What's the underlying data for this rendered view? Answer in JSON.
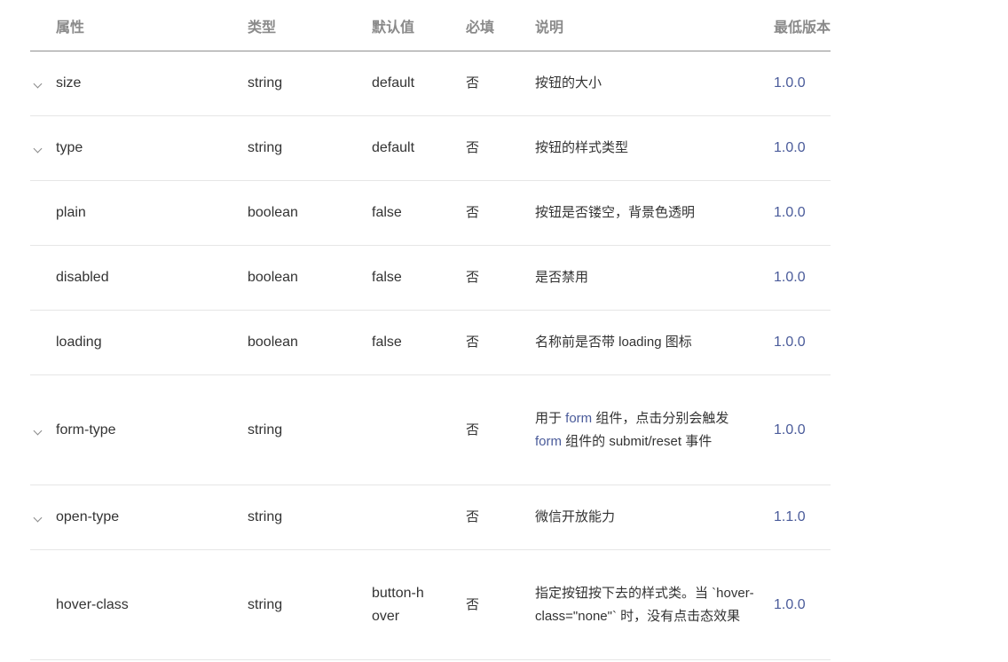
{
  "headers": {
    "attr": "属性",
    "type": "类型",
    "default": "默认值",
    "required": "必填",
    "desc": "说明",
    "version": "最低版本"
  },
  "rows": [
    {
      "expandable": true,
      "attr": "size",
      "type": "string",
      "default": "default",
      "required": "否",
      "desc": "按钮的大小",
      "version": "1.0.0"
    },
    {
      "expandable": true,
      "attr": "type",
      "type": "string",
      "default": "default",
      "required": "否",
      "desc": "按钮的样式类型",
      "version": "1.0.0"
    },
    {
      "expandable": false,
      "attr": "plain",
      "type": "boolean",
      "default": "false",
      "required": "否",
      "desc": "按钮是否镂空，背景色透明",
      "version": "1.0.0"
    },
    {
      "expandable": false,
      "attr": "disabled",
      "type": "boolean",
      "default": "false",
      "required": "否",
      "desc": "是否禁用",
      "version": "1.0.0"
    },
    {
      "expandable": false,
      "attr": "loading",
      "type": "boolean",
      "default": "false",
      "required": "否",
      "desc": "名称前是否带 loading 图标",
      "version": "1.0.0"
    },
    {
      "expandable": true,
      "attr": "form-type",
      "type": "string",
      "default": "",
      "required": "否",
      "desc_parts": {
        "p1": "用于 ",
        "link1": "form",
        "p2": " 组件，点击分别会触发 ",
        "link2": "form",
        "p3": " 组件的 submit/reset 事件"
      },
      "version": "1.0.0"
    },
    {
      "expandable": true,
      "attr": "open-type",
      "type": "string",
      "default": "",
      "required": "否",
      "desc": "微信开放能力",
      "version": "1.1.0"
    },
    {
      "expandable": false,
      "attr": "hover-class",
      "type": "string",
      "default": "button-hover",
      "required": "否",
      "desc": "指定按钮按下去的样式类。当 `hover-class=\"none\"` 时，没有点击态效果",
      "version": "1.0.0"
    }
  ],
  "icons": {
    "expand": "chevron-down-icon"
  }
}
